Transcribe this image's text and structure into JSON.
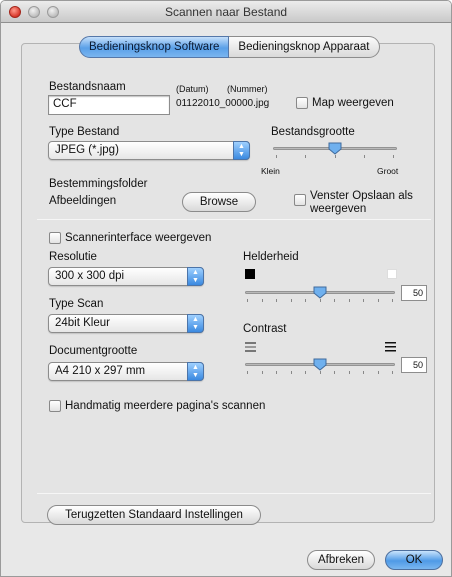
{
  "window": {
    "title": "Scannen naar Bestand"
  },
  "tabs": [
    {
      "label": "Bedieningsknop Software",
      "selected": true
    },
    {
      "label": "Bedieningsknop Apparaat",
      "selected": false
    }
  ],
  "file": {
    "name_label": "Bestandsnaam",
    "date_label": "(Datum)",
    "number_label": "(Nummer)",
    "name_value": "CCF",
    "generated_name": "01122010_00000.jpg",
    "show_folder_label": "Map weergeven",
    "show_folder_checked": false
  },
  "file_type": {
    "label": "Type Bestand",
    "selected": "JPEG (*.jpg)"
  },
  "file_size": {
    "label": "Bestandsgrootte",
    "min_label": "Klein",
    "max_label": "Groot",
    "level_fraction": 0.5
  },
  "destination": {
    "label": "Bestemmingsfolder",
    "folder": "Afbeeldingen",
    "browse_label": "Browse",
    "save_as_label_line1": "Venster Opslaan als",
    "save_as_label_line2": "weergeven",
    "save_as_checked": false
  },
  "scanner": {
    "interface_label": "Scannerinterface weergeven",
    "interface_checked": false,
    "resolution_label": "Resolutie",
    "resolution_value": "300 x 300 dpi",
    "scan_type_label": "Type Scan",
    "scan_type_value": "24bit Kleur",
    "doc_size_label": "Documentgrootte",
    "doc_size_value": "A4  210 x 297 mm",
    "multi_page_label": "Handmatig meerdere pagina's scannen",
    "multi_page_checked": false
  },
  "brightness": {
    "label": "Helderheid",
    "value": "50",
    "level_fraction": 0.5
  },
  "contrast": {
    "label": "Contrast",
    "value": "50",
    "level_fraction": 0.5
  },
  "footer": {
    "reset_label": "Terugzetten Standaard Instellingen",
    "cancel_label": "Afbreken",
    "ok_label": "OK"
  },
  "colors": {
    "accent_blue": "#4f9ae6",
    "selected_tab": "#5aa0e8",
    "close_red": "#d8372a"
  }
}
